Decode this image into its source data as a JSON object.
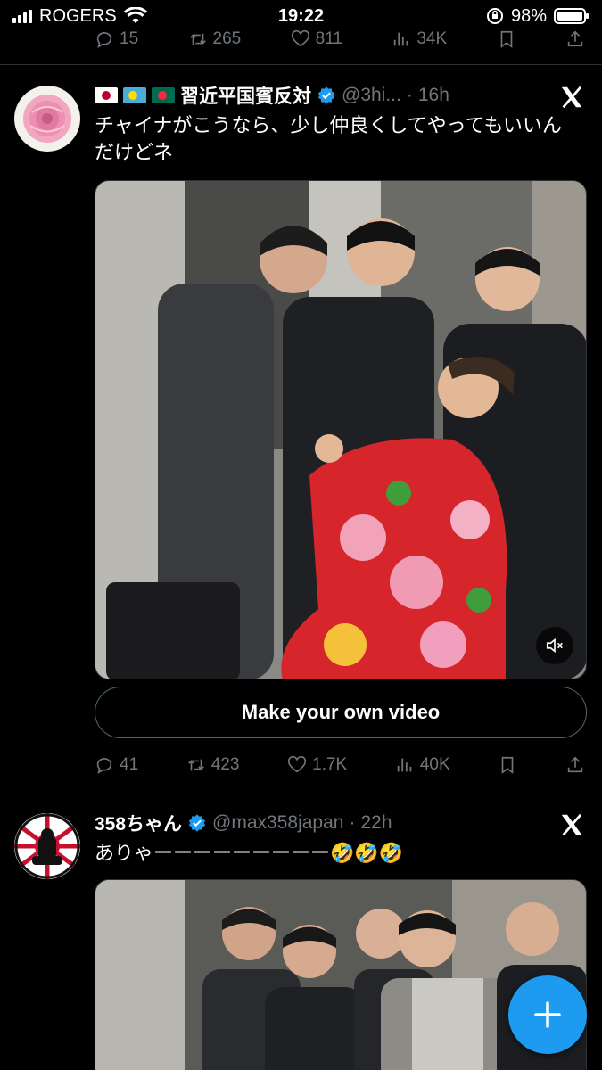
{
  "status_bar": {
    "carrier": "ROGERS",
    "time": "19:22",
    "battery": "98%"
  },
  "previous_tweet": {
    "actions": {
      "replies": "15",
      "reposts": "265",
      "likes": "811",
      "views": "34K"
    }
  },
  "tweet1": {
    "display_name": "習近平国賓反対",
    "handle": "@3hi...",
    "separator": "·",
    "time": "16h",
    "flags": [
      "japan-flag",
      "palau-flag",
      "bangladesh-flag"
    ],
    "text": "チャイナがこうなら、少し仲良くしてやってもいいんだけどネ",
    "cta_label": "Make your own video",
    "actions": {
      "replies": "41",
      "reposts": "423",
      "likes": "1.7K",
      "views": "40K"
    }
  },
  "tweet2": {
    "display_name": "358ちゃん",
    "handle": "@max358japan",
    "separator": "·",
    "time": "22h",
    "text": "ありゃーーーーーーーーー🤣🤣🤣"
  },
  "icons": {
    "reply": "reply-icon",
    "repost": "repost-icon",
    "like": "heart-icon",
    "views": "views-icon",
    "bookmark": "bookmark-icon",
    "share": "share-icon",
    "compose": "plus-icon",
    "mute": "muted-speaker-icon",
    "x_logo": "x-logo-icon"
  },
  "colors": {
    "accent": "#1d9bf0",
    "muted": "#71767b",
    "background": "#000000"
  }
}
